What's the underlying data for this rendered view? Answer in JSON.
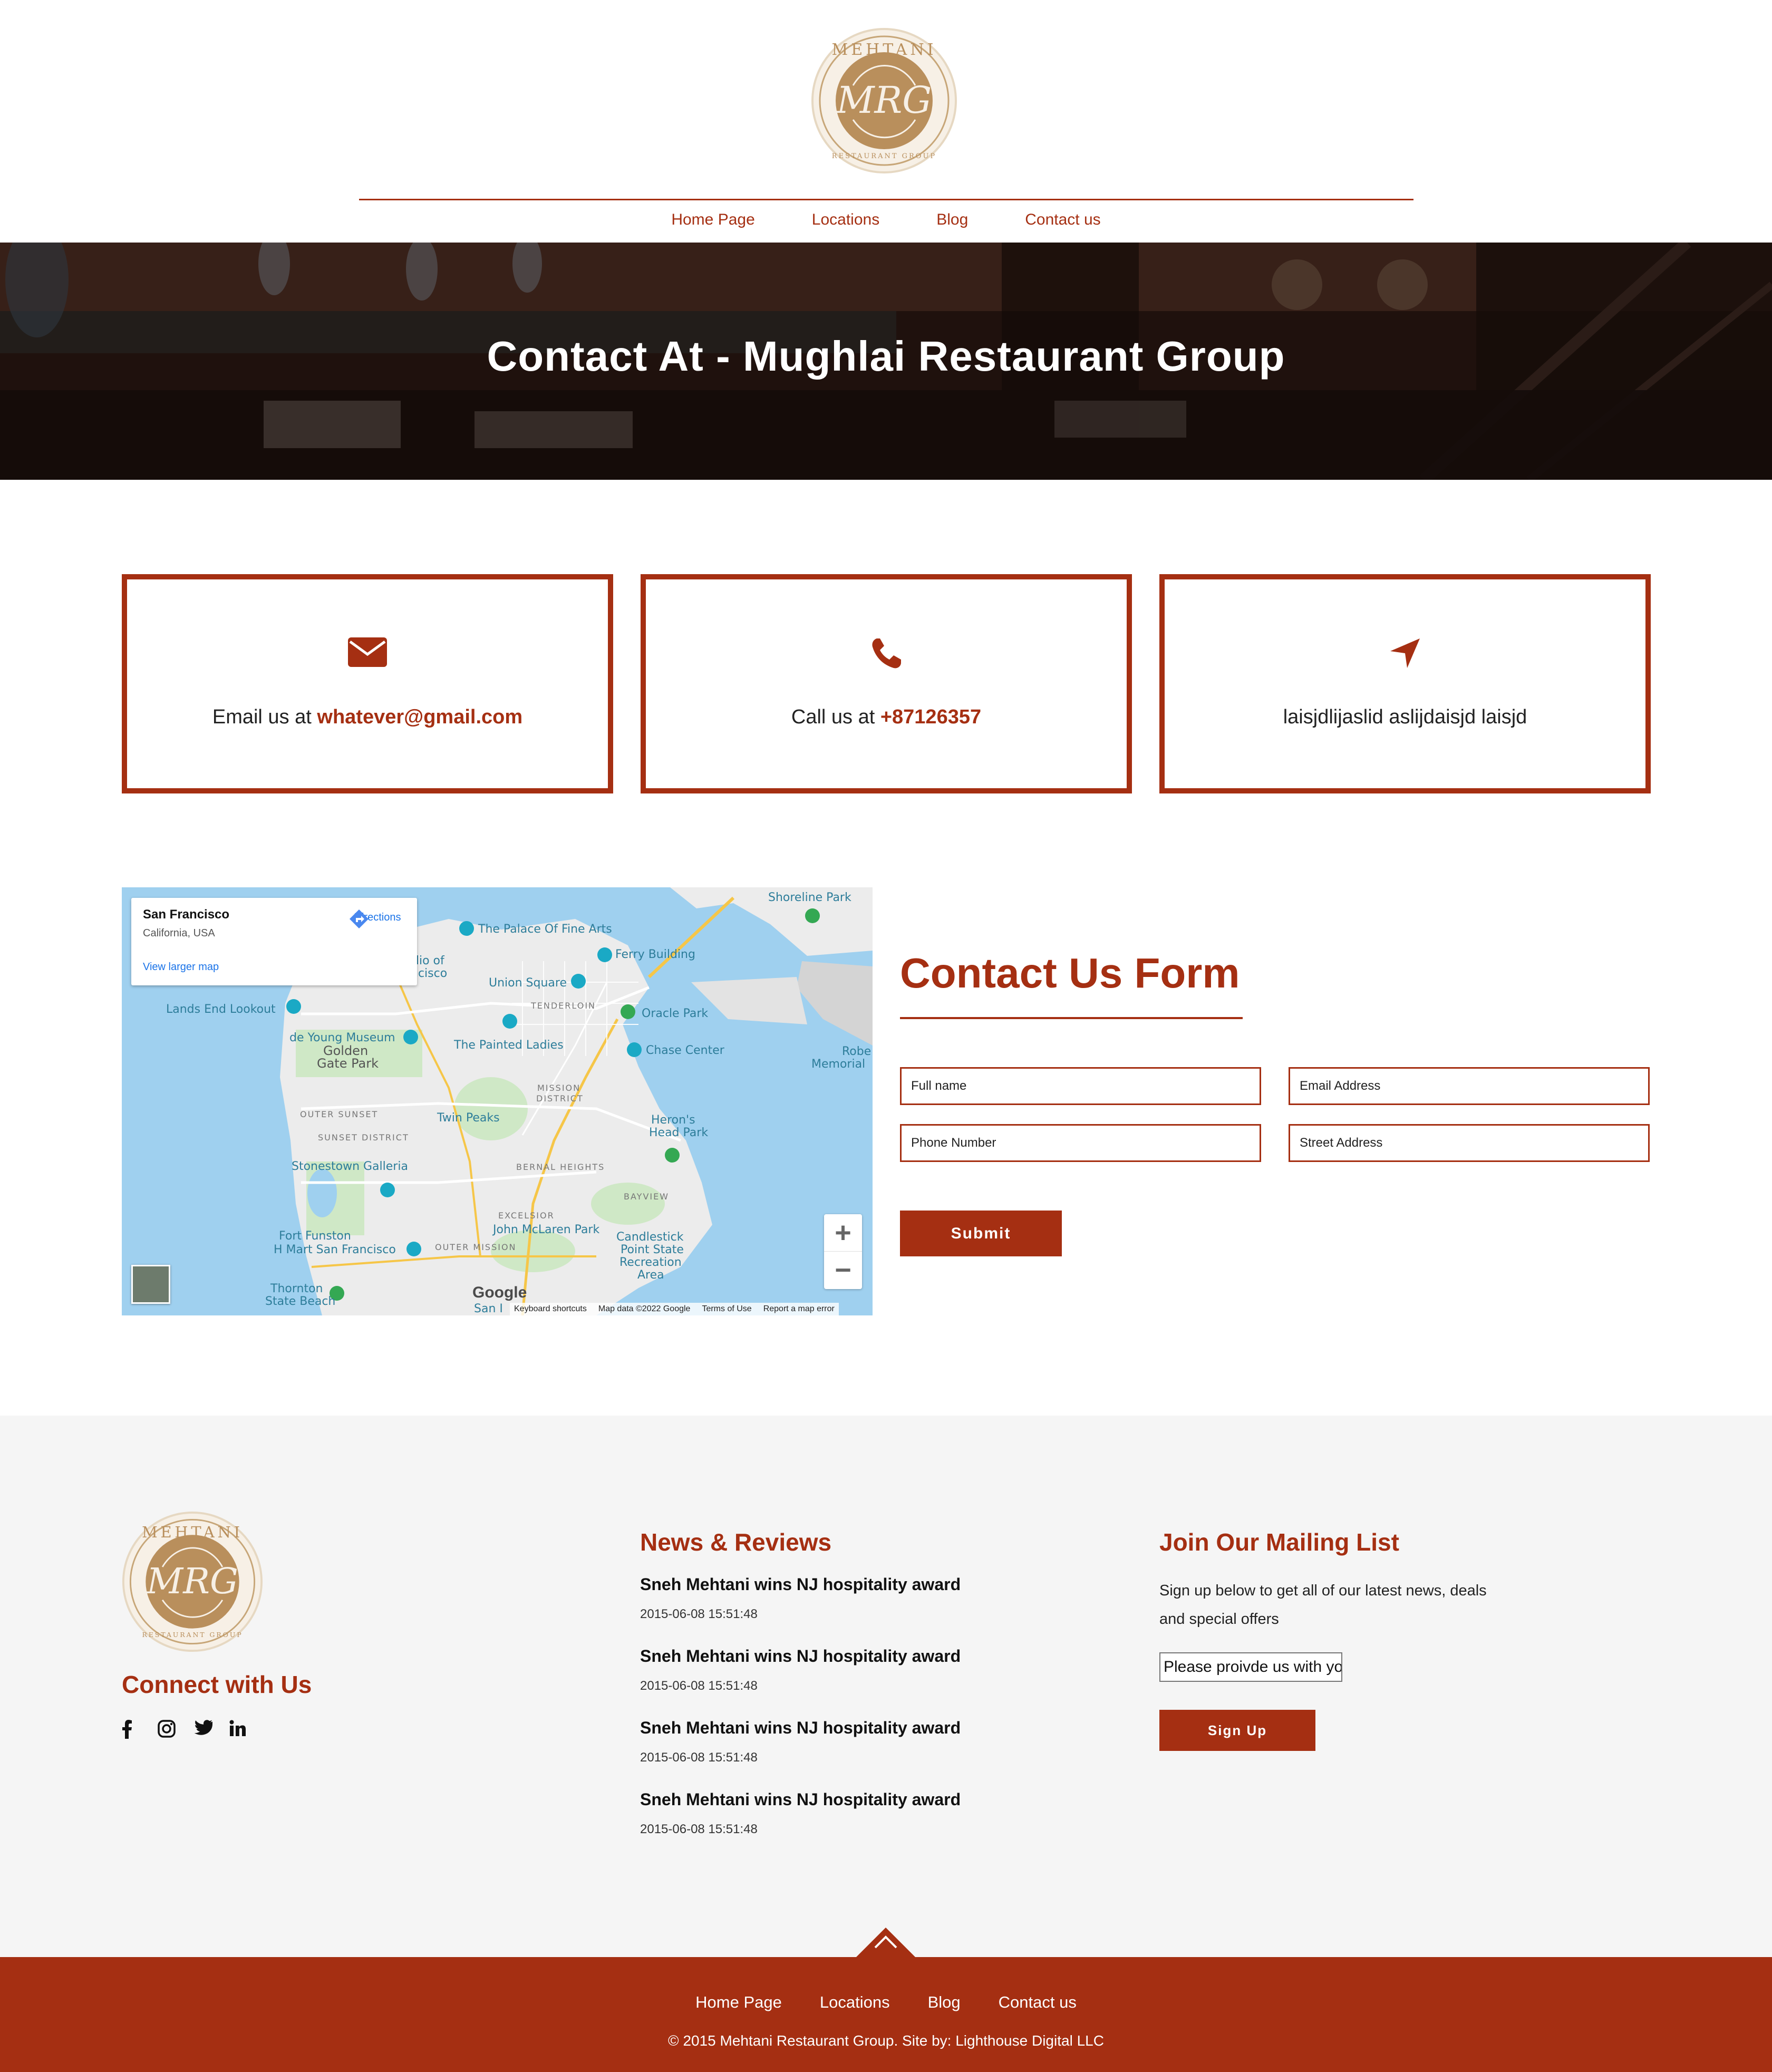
{
  "brand": {
    "logo_text": "MEHTANI",
    "logo_subtext": "RESTAURANT GROUP",
    "primary_color": "#a52f12"
  },
  "nav": {
    "items": [
      {
        "label": "Home Page"
      },
      {
        "label": "Locations"
      },
      {
        "label": "Blog"
      },
      {
        "label": "Contact us"
      }
    ]
  },
  "hero": {
    "title": "Contact At - Mughlai Restaurant Group"
  },
  "cards": {
    "email": {
      "icon": "envelope-icon",
      "prefix": "Email us at ",
      "value": "whatever@gmail.com"
    },
    "phone": {
      "icon": "phone-icon",
      "prefix": "Call us at ",
      "value": "+87126357"
    },
    "address": {
      "icon": "location-arrow-icon",
      "value": "laisjdlijaslid aslijdaisjd laisjd"
    }
  },
  "map": {
    "place": "San Francisco",
    "region": "California, USA",
    "larger_map": "View larger map",
    "directions": "Directions",
    "google": "Google",
    "attribution": [
      "Keyboard shortcuts",
      "Map data ©2022 Google",
      "Terms of Use",
      "Report a map error"
    ],
    "labels": [
      "The Palace Of Fine Arts",
      "Ferry Building",
      "Shoreline Park",
      "Union Square",
      "TENDERLOIN",
      "Lands End Lookout",
      "Oracle Park",
      "de Young Museum",
      "Golden",
      "Gate Park",
      "The Painted Ladies",
      "Chase Center",
      "Robe",
      "Memorial",
      "OUTER SUNSET",
      "SUNSET DISTRICT",
      "MISSION",
      "DISTRICT",
      "Twin Peaks",
      "Heron's",
      "Head Park",
      "Stonestown Galleria",
      "BERNAL HEIGHTS",
      "BAYVIEW",
      "EXCELSIOR",
      "Fort Funston",
      "H Mart San Francisco",
      "John McLaren Park",
      "OUTER MISSION",
      "Candlestick",
      "Point State",
      "Recreation",
      "Area",
      "Thornton",
      "State Beach",
      "dio of",
      "ncisco",
      "San I"
    ]
  },
  "form": {
    "title": "Contact Us Form",
    "fields": {
      "full_name": "Full name",
      "email": "Email Address",
      "phone": "Phone Number",
      "street": "Street Address"
    },
    "submit": "Submit"
  },
  "footer": {
    "connect_title": "Connect with Us",
    "socials": [
      "facebook-icon",
      "instagram-icon",
      "twitter-icon",
      "linkedin-icon"
    ],
    "news_title": "News & Reviews",
    "news": [
      {
        "title": "Sneh Mehtani wins NJ hospitality award",
        "date": "2015-06-08 15:51:48"
      },
      {
        "title": "Sneh Mehtani wins NJ hospitality award",
        "date": "2015-06-08 15:51:48"
      },
      {
        "title": "Sneh Mehtani wins NJ hospitality award",
        "date": "2015-06-08 15:51:48"
      },
      {
        "title": "Sneh Mehtani wins NJ hospitality award",
        "date": "2015-06-08 15:51:48"
      }
    ],
    "mailing_title": "Join Our Mailing List",
    "mailing_desc": "Sign up below to get all of our latest news, deals and special offers",
    "mailing_placeholder": "Please proivde us with your email",
    "signup": "Sign Up",
    "bottom_nav": [
      {
        "label": "Home Page"
      },
      {
        "label": "Locations"
      },
      {
        "label": "Blog"
      },
      {
        "label": "Contact us"
      }
    ],
    "copyright": "© 2015 Mehtani Restaurant Group. Site by: Lighthouse Digital LLC"
  }
}
